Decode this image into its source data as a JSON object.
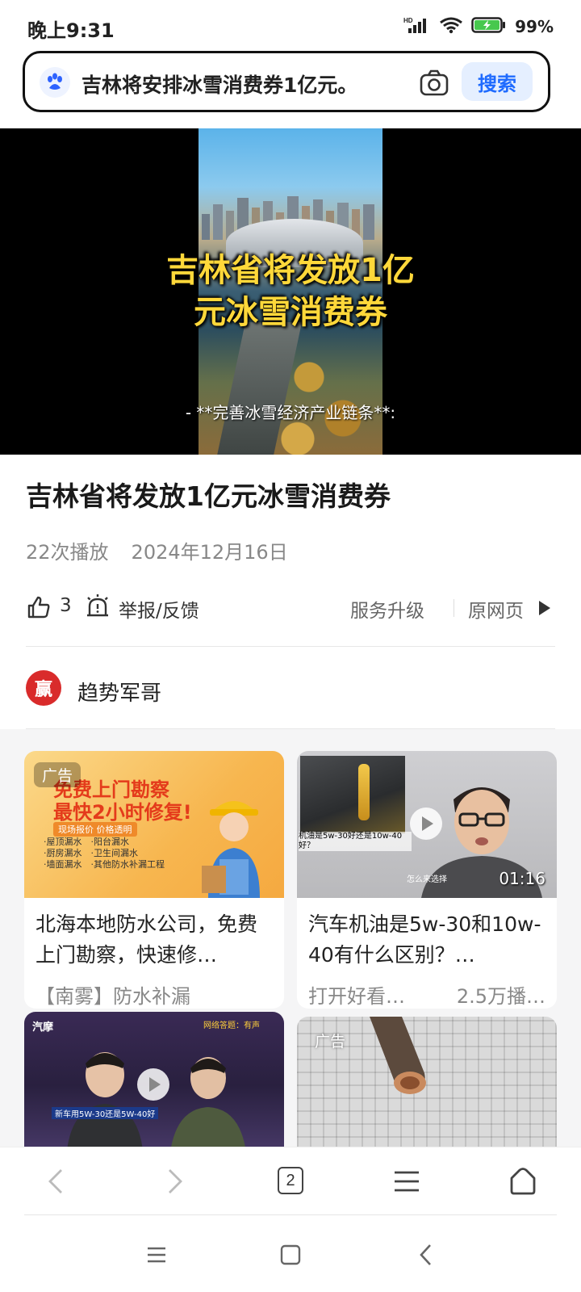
{
  "status_bar": {
    "time": "晚上9:31",
    "battery_percent": "99%",
    "hd_label": "HD"
  },
  "search": {
    "query": "吉林将安排冰雪消费券1亿元。",
    "button_label": "搜索"
  },
  "video": {
    "title_line1": "吉林省将发放1亿",
    "title_line2": "元冰雪消费券",
    "subtitle": "- **完善冰雪经济产业链条**:"
  },
  "article": {
    "title": "吉林省将发放1亿元冰雪消费券",
    "play_count": "22次播放",
    "date": "2024年12月16日",
    "like_count": "3",
    "report_label": "举报/反馈",
    "service_label": "服务升级",
    "original_label": "原网页"
  },
  "author": {
    "avatar_char": "赢",
    "name": "趋势军哥"
  },
  "feed": {
    "cards": [
      {
        "ad_label": "广告",
        "thumb_line1": "免费上门勘察",
        "thumb_line2": "最快2小时修复!",
        "thumb_badge": "现场报价 价格透明",
        "thumb_list": "·屋顶漏水　·阳台漏水\n·厨房漏水　·卫生间漏水\n·墙面漏水　·其他防水补漏工程",
        "title": "北海本地防水公司，免费上门勘察，快速修…",
        "source": "【南雾】防水补漏",
        "stat": ""
      },
      {
        "ad_label": "",
        "thumb_caption": "机油是5w-30好还是10w-40好？",
        "thumb_sub": "怎么来选择",
        "duration": "01:16",
        "title": "汽车机油是5w-30和10w-40有什么区别？…",
        "source": "打开好看…",
        "stat": "2.5万播…"
      },
      {
        "ad_label": "",
        "thumb_brand": "汽摩",
        "thumb_caption": "新车用5W-30还是5W-40好",
        "thumb_top": "网络答题：有声"
      },
      {
        "ad_label": "广告"
      }
    ]
  },
  "browser_nav": {
    "tab_count": "2"
  },
  "colors": {
    "accent": "#1f6bff",
    "title_yellow": "#ffd83a"
  }
}
